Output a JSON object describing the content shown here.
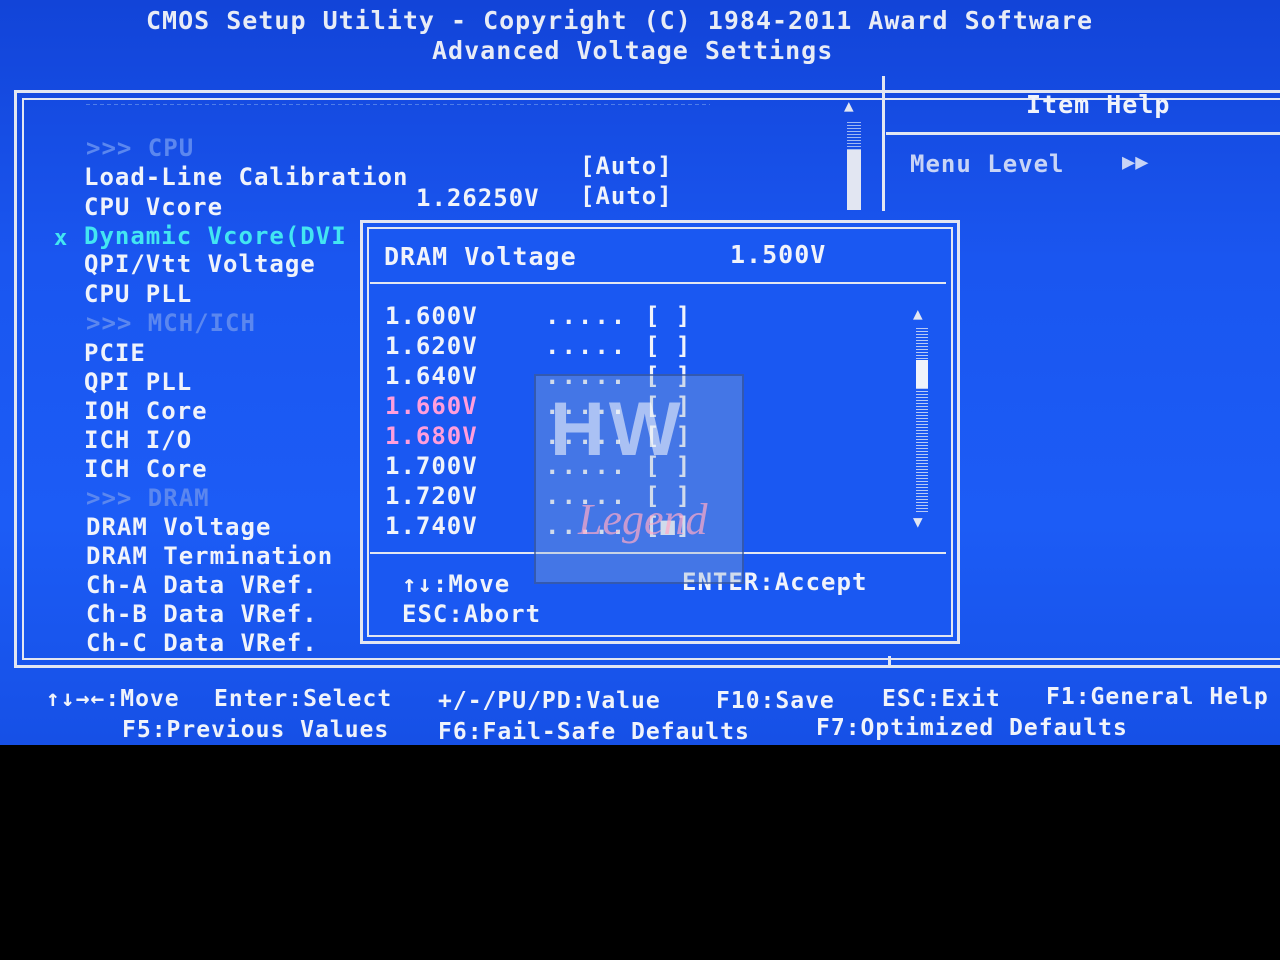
{
  "header": {
    "line1": "CMOS Setup Utility - Copyright (C) 1984-2011 Award Software",
    "line2": "Advanced Voltage Settings"
  },
  "menu": {
    "items": [
      {
        "label": ">>> CPU",
        "style": "section"
      },
      {
        "label": "Load-Line Calibration",
        "style": "normal"
      },
      {
        "label": "CPU Vcore",
        "style": "normal"
      },
      {
        "label": "Dynamic Vcore(DVI",
        "style": "selected",
        "marker": "x"
      },
      {
        "label": "QPI/Vtt Voltage",
        "style": "normal"
      },
      {
        "label": "CPU PLL",
        "style": "normal"
      },
      {
        "label": ">>> MCH/ICH",
        "style": "section"
      },
      {
        "label": "PCIE",
        "style": "normal"
      },
      {
        "label": "QPI PLL",
        "style": "normal"
      },
      {
        "label": "IOH Core",
        "style": "normal"
      },
      {
        "label": "ICH I/O",
        "style": "normal"
      },
      {
        "label": "ICH Core",
        "style": "normal"
      },
      {
        "label": ">>> DRAM",
        "style": "section"
      },
      {
        "label": "DRAM Voltage",
        "style": "normal"
      },
      {
        "label": "DRAM Termination",
        "style": "normal"
      },
      {
        "label": "Ch-A Data VRef.",
        "style": "normal"
      },
      {
        "label": "Ch-B Data VRef.",
        "style": "normal"
      },
      {
        "label": "Ch-C Data VRef.",
        "style": "normal"
      }
    ],
    "values": {
      "load_line": "[Auto]",
      "cpu_vcore_reading": "1.26250V",
      "cpu_vcore": "[Auto]"
    }
  },
  "help": {
    "title": "Item Help",
    "menu_level": "Menu Level",
    "level_arrows": "▶▶"
  },
  "popup": {
    "title": "DRAM Voltage",
    "current": "1.500V",
    "options": [
      {
        "value": "1.600V",
        "dots": ".....",
        "box": "[ ]",
        "highlight": false
      },
      {
        "value": "1.620V",
        "dots": ".....",
        "box": "[ ]",
        "highlight": false
      },
      {
        "value": "1.640V",
        "dots": ".....",
        "box": "[ ]",
        "highlight": false
      },
      {
        "value": "1.660V",
        "dots": ".....",
        "box": "[ ]",
        "highlight": true
      },
      {
        "value": "1.680V",
        "dots": ".....",
        "box": "[ ]",
        "highlight": true
      },
      {
        "value": "1.700V",
        "dots": ".....",
        "box": "[ ]",
        "highlight": false
      },
      {
        "value": "1.720V",
        "dots": ".....",
        "box": "[ ]",
        "highlight": false
      },
      {
        "value": "1.740V",
        "dots": ".....",
        "box": "[■]",
        "highlight": false
      }
    ],
    "keys": {
      "move": "↑↓:Move",
      "accept": "ENTER:Accept",
      "abort": "ESC:Abort"
    }
  },
  "watermark": {
    "top": "HW",
    "bottom": "Legend"
  },
  "footer": {
    "line1": [
      "↑↓→←:Move",
      "Enter:Select",
      "+/-/PU/PD:Value",
      "F10:Save",
      "ESC:Exit",
      "F1:General Help"
    ],
    "line2": [
      "F5:Previous Values",
      "F6:Fail-Safe Defaults",
      "F7:Optimized Defaults"
    ]
  },
  "colors": {
    "background": "#1c5cf6",
    "text": "#f0f3fb",
    "section": "#5b87ef",
    "selected": "#43e6f2",
    "highlight": "#ff9edc"
  }
}
